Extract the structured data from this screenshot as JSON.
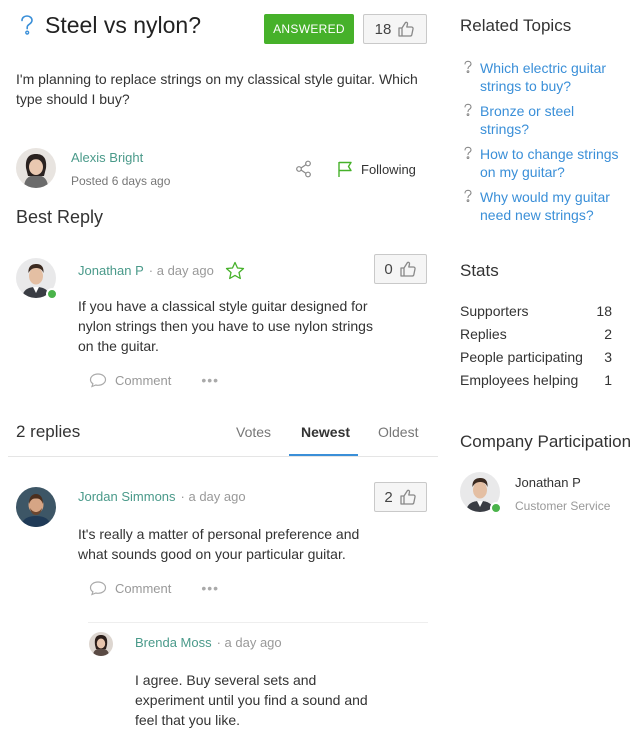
{
  "question": {
    "title": "Steel vs nylon?",
    "status_badge": "ANSWERED",
    "votes": "18",
    "body": "I'm planning to replace strings on my classical style guitar. Which type should I buy?",
    "author": {
      "name": "Alexis Bright",
      "posted": "Posted 6 days ago"
    },
    "follow_label": "Following"
  },
  "best_reply": {
    "heading": "Best Reply",
    "author": "Jonathan P",
    "time": "· a day ago",
    "votes": "0",
    "body": "If you have a classical style guitar designed for nylon strings then you have to use nylon strings on the guitar.",
    "comment_label": "Comment"
  },
  "replies": {
    "count_label": "2 replies",
    "sort_tabs": [
      "Votes",
      "Newest",
      "Oldest"
    ],
    "active_sort": "Newest",
    "items": [
      {
        "author": "Jordan Simmons",
        "time": "· a day ago",
        "votes": "2",
        "body": "It's really a matter of personal preference and what sounds good on your particular guitar.",
        "comment_label": "Comment"
      }
    ],
    "nested": {
      "author": "Brenda Moss",
      "time": "· a day ago",
      "body": "I agree. Buy several sets and experiment until you find a sound and feel that you like."
    }
  },
  "sidebar": {
    "related_heading": "Related Topics",
    "related_topics": [
      "Which electric guitar strings to buy?",
      "Bronze or steel strings?",
      "How to change strings on my guitar?",
      "Why would my guitar need new strings?"
    ],
    "stats_heading": "Stats",
    "stats": [
      {
        "label": "Supporters",
        "value": "18"
      },
      {
        "label": "Replies",
        "value": "2"
      },
      {
        "label": "People participating",
        "value": "3"
      },
      {
        "label": "Employees helping",
        "value": "1"
      }
    ],
    "company_heading": "Company Participation",
    "company_member": {
      "name": "Jonathan P",
      "role": "Customer Service"
    }
  },
  "colors": {
    "accent_blue": "#3a8fd8",
    "answered_green": "#46b12a",
    "author_teal": "#4a9a8a",
    "online_green": "#4ab34a"
  },
  "icons": [
    "question-icon",
    "thumbs-up-icon",
    "share-icon",
    "flag-icon",
    "star-icon",
    "comment-icon",
    "more-icon"
  ]
}
